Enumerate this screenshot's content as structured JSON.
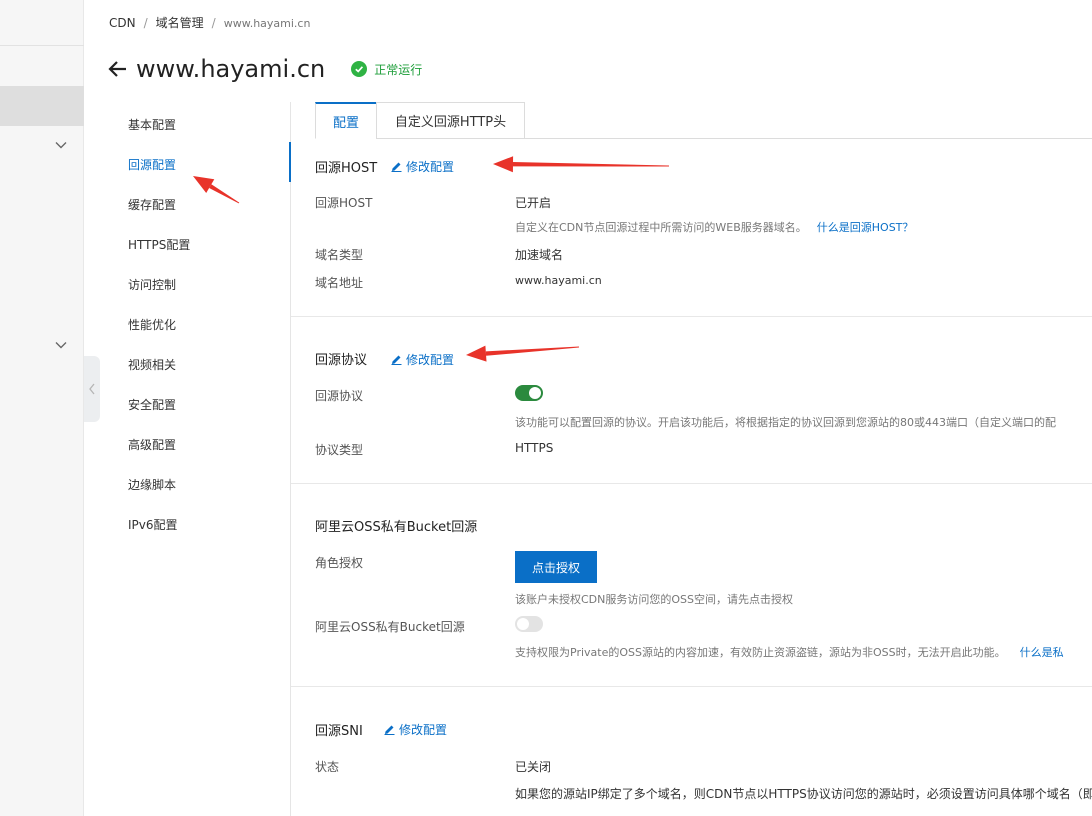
{
  "breadcrumb": {
    "root": "CDN",
    "level2": "域名管理",
    "current": "www.hayami.cn",
    "sep": "/"
  },
  "header": {
    "title": "www.hayami.cn",
    "status": "正常运行"
  },
  "subnav": {
    "items": [
      {
        "label": "基本配置"
      },
      {
        "label": "回源配置"
      },
      {
        "label": "缓存配置"
      },
      {
        "label": "HTTPS配置"
      },
      {
        "label": "访问控制"
      },
      {
        "label": "性能优化"
      },
      {
        "label": "视频相关"
      },
      {
        "label": "安全配置"
      },
      {
        "label": "高级配置"
      },
      {
        "label": "边缘脚本"
      },
      {
        "label": "IPv6配置"
      }
    ],
    "active_index": 1
  },
  "tabs": [
    {
      "label": "配置"
    },
    {
      "label": "自定义回源HTTP头"
    }
  ],
  "sections": {
    "host": {
      "title": "回源HOST",
      "edit": "修改配置",
      "host_label": "回源HOST",
      "host_value": "已开启",
      "host_help": "自定义在CDN节点回源过程中所需访问的WEB服务器域名。",
      "host_help_link": "什么是回源HOST？",
      "type_label": "域名类型",
      "type_value": "加速域名",
      "addr_label": "域名地址",
      "addr_value": "www.hayami.cn"
    },
    "protocol": {
      "title": "回源协议",
      "edit": "修改配置",
      "proto_label": "回源协议",
      "proto_enabled": true,
      "proto_help": "该功能可以配置回源的协议。开启该功能后，将根据指定的协议回源到您源站的80或443端口（自定义端口的配",
      "type_label": "协议类型",
      "type_value": "HTTPS"
    },
    "oss": {
      "title": "阿里云OSS私有Bucket回源",
      "role_label": "角色授权",
      "auth_button": "点击授权",
      "auth_help": "该账户未授权CDN服务访问您的OSS空间，请先点击授权",
      "bucket_label": "阿里云OSS私有Bucket回源",
      "bucket_enabled": false,
      "bucket_help": "支持权限为Private的OSS源站的内容加速，有效防止资源盗链，源站为非OSS时，无法开启此功能。",
      "bucket_help_link": "什么是私"
    },
    "sni": {
      "title": "回源SNI",
      "edit": "修改配置",
      "state_label": "状态",
      "state_value": "已关闭",
      "help": "如果您的源站IP绑定了多个域名，则CDN节点以HTTPS协议访问您的源站时，必须设置访问具体哪个域名（即"
    }
  },
  "colors": {
    "accent": "#0a6fc7",
    "success": "#2fb344",
    "toggle_on": "#2b8a3e",
    "toggle_off": "#e3e3e3",
    "annotation_arrow": "#e8332a"
  }
}
